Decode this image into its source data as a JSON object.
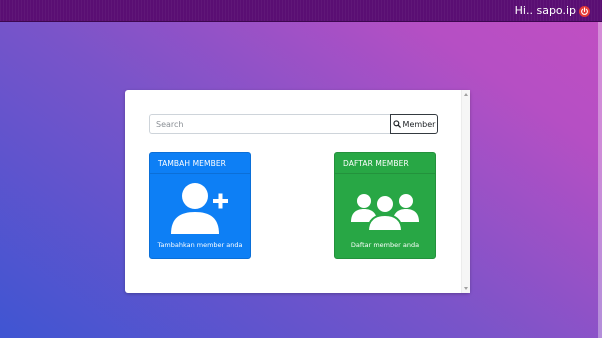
{
  "header": {
    "greeting": "Hi.. sapo.ip",
    "logout_icon": "power-icon"
  },
  "search": {
    "placeholder": "Search",
    "value": "",
    "button_label": "Member",
    "button_icon": "search-icon"
  },
  "cards": [
    {
      "title": "TAMBAH MEMBER",
      "caption": "Tambahkan member anda",
      "icon": "user-plus-icon",
      "color": "#0d7ff5"
    },
    {
      "title": "DAFTAR MEMBER",
      "caption": "Daftar member anda",
      "icon": "users-group-icon",
      "color": "#28a745"
    }
  ],
  "colors": {
    "topbar": "#5a0e73",
    "logout": "#e53935"
  }
}
